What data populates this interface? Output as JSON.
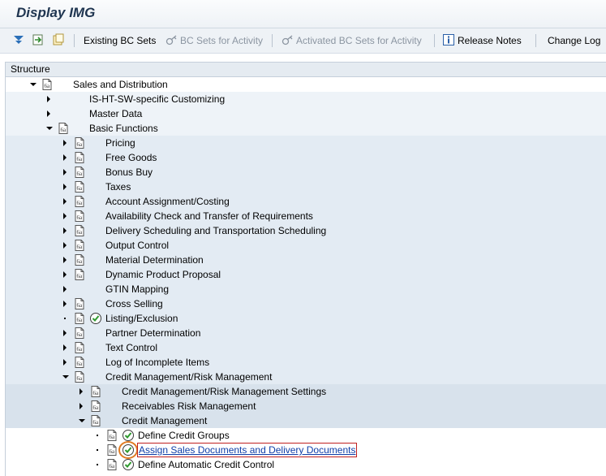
{
  "title": "Display IMG",
  "toolbar": {
    "existing_bc_sets": "Existing BC Sets",
    "bc_sets_for_activity": "BC Sets for Activity",
    "activated_bc_sets": "Activated BC Sets for Activity",
    "release_notes": "Release Notes",
    "change_log": "Change Log"
  },
  "tree": {
    "header": "Structure",
    "nodes": [
      {
        "label": "Sales and Distribution",
        "level": 0,
        "state": "expanded",
        "doc": true,
        "exec": false
      },
      {
        "label": "IS-HT-SW-specific Customizing",
        "level": 1,
        "state": "collapsed",
        "doc": false,
        "exec": false
      },
      {
        "label": "Master Data",
        "level": 1,
        "state": "collapsed",
        "doc": false,
        "exec": false
      },
      {
        "label": "Basic Functions",
        "level": 1,
        "state": "expanded",
        "doc": true,
        "exec": false
      },
      {
        "label": "Pricing",
        "level": 2,
        "state": "collapsed",
        "doc": true,
        "exec": false
      },
      {
        "label": "Free Goods",
        "level": 2,
        "state": "collapsed",
        "doc": true,
        "exec": false
      },
      {
        "label": "Bonus Buy",
        "level": 2,
        "state": "collapsed",
        "doc": true,
        "exec": false
      },
      {
        "label": "Taxes",
        "level": 2,
        "state": "collapsed",
        "doc": true,
        "exec": false
      },
      {
        "label": "Account Assignment/Costing",
        "level": 2,
        "state": "collapsed",
        "doc": true,
        "exec": false
      },
      {
        "label": "Availability Check and Transfer of Requirements",
        "level": 2,
        "state": "collapsed",
        "doc": true,
        "exec": false
      },
      {
        "label": "Delivery Scheduling and Transportation Scheduling",
        "level": 2,
        "state": "collapsed",
        "doc": true,
        "exec": false
      },
      {
        "label": "Output Control",
        "level": 2,
        "state": "collapsed",
        "doc": true,
        "exec": false
      },
      {
        "label": "Material Determination",
        "level": 2,
        "state": "collapsed",
        "doc": true,
        "exec": false
      },
      {
        "label": "Dynamic Product Proposal",
        "level": 2,
        "state": "collapsed",
        "doc": true,
        "exec": false
      },
      {
        "label": "GTIN Mapping",
        "level": 2,
        "state": "collapsed",
        "doc": false,
        "exec": false
      },
      {
        "label": "Cross Selling",
        "level": 2,
        "state": "collapsed",
        "doc": true,
        "exec": false
      },
      {
        "label": "Listing/Exclusion",
        "level": 2,
        "state": "leaf",
        "doc": true,
        "exec": true
      },
      {
        "label": "Partner Determination",
        "level": 2,
        "state": "collapsed",
        "doc": true,
        "exec": false
      },
      {
        "label": "Text Control",
        "level": 2,
        "state": "collapsed",
        "doc": true,
        "exec": false
      },
      {
        "label": "Log of Incomplete Items",
        "level": 2,
        "state": "collapsed",
        "doc": true,
        "exec": false
      },
      {
        "label": "Credit Management/Risk Management",
        "level": 2,
        "state": "expanded",
        "doc": true,
        "exec": false
      },
      {
        "label": "Credit Management/Risk Management Settings",
        "level": 3,
        "state": "collapsed",
        "doc": true,
        "exec": false
      },
      {
        "label": "Receivables Risk Management",
        "level": 3,
        "state": "collapsed",
        "doc": true,
        "exec": false
      },
      {
        "label": "Credit Management",
        "level": 3,
        "state": "expanded",
        "doc": true,
        "exec": false
      },
      {
        "label": "Define Credit Groups",
        "level": 4,
        "state": "leaf",
        "doc": true,
        "exec": true
      },
      {
        "label": "Assign Sales Documents and Delivery Documents",
        "level": 4,
        "state": "leaf",
        "doc": true,
        "exec": true,
        "selected": true
      },
      {
        "label": "Define Automatic Credit Control",
        "level": 4,
        "state": "leaf",
        "doc": true,
        "exec": true
      }
    ]
  },
  "colors": {
    "title": "#1f3550",
    "selection_border": "#c02020",
    "highlight_ring": "#e07b22",
    "link": "#0f3ea8",
    "band_level0": "#ffffff",
    "band_level1": "#eef3f8",
    "band_level2": "#e3ebf3",
    "band_level3": "#d8e2ec",
    "band_level4": "#ffffff"
  }
}
